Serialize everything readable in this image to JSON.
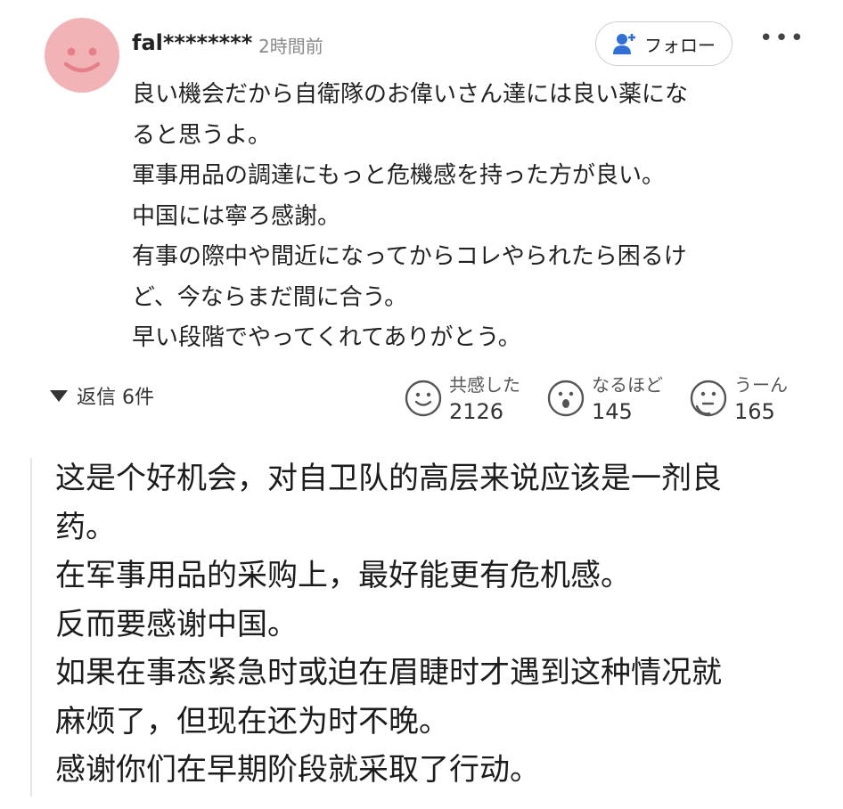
{
  "header": {
    "username": "fal********",
    "timestamp": "2時間前",
    "follow_label": "フォロー",
    "more_label": "•••"
  },
  "comment": {
    "text": "良い機会だから自衛隊のお偉いさん達には良い薬にな\nると思うよ。\n軍事用品の調達にもっと危機感を持った方が良い。\n中国には寧ろ感謝。\n有事の際中や間近になってからコレやられたら困るけ\nど、今ならまだ間に合う。\n早い段階でやってくれてありがとう。"
  },
  "replies": {
    "label": "返信 6件"
  },
  "reactions": [
    {
      "label": "共感した",
      "count": "2126",
      "icon": "smile-face-icon"
    },
    {
      "label": "なるほど",
      "count": "145",
      "icon": "surprised-face-icon"
    },
    {
      "label": "うーん",
      "count": "165",
      "icon": "thinking-face-icon"
    }
  ],
  "translation": {
    "text": "这是个好机会，对自卫队的高层来说应该是一剂良\n药。\n在军事用品的采购上，最好能更有危机感。\n反而要感谢中国。\n如果在事态紧急时或迫在眉睫时才遇到这种情况就\n麻烦了，但现在还为时不晚。\n感谢你们在早期阶段就采取了行动。"
  },
  "colors": {
    "avatar": "#f2b3b7",
    "follow_icon": "#2f6fd6"
  }
}
